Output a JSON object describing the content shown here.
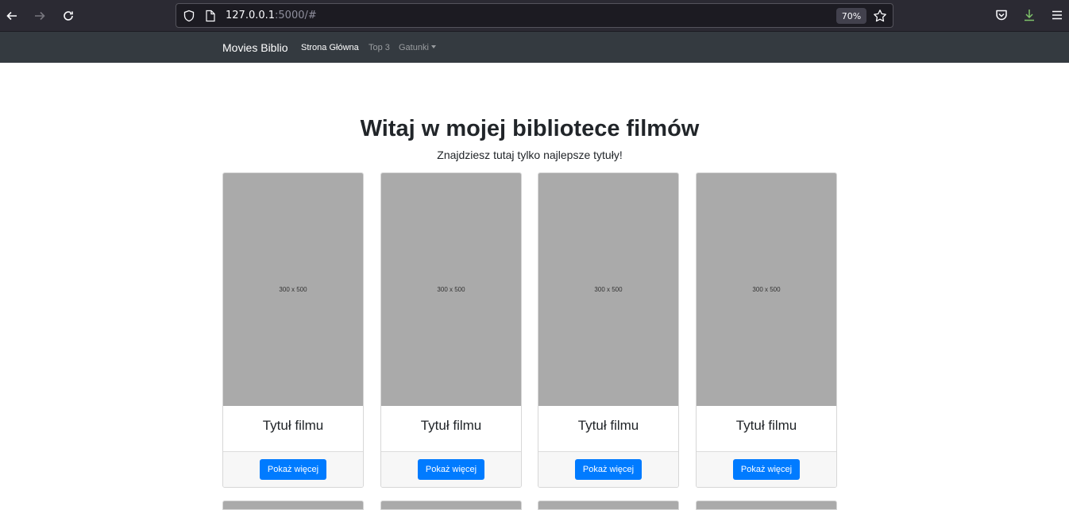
{
  "browser": {
    "url_host": "127.0.0.1",
    "url_rest": ":5000/#",
    "zoom": "70%"
  },
  "navbar": {
    "brand": "Movies Biblio",
    "links": [
      {
        "label": "Strona Główna",
        "active": true
      },
      {
        "label": "Top 3",
        "active": false
      },
      {
        "label": "Gatunki",
        "active": false,
        "dropdown": true
      }
    ]
  },
  "hero": {
    "title": "Witaj w mojej bibliotece filmów",
    "subtitle": "Znajdziesz tutaj tylko najlepsze tytuły!"
  },
  "cards": [
    {
      "placeholder": "300 x 500",
      "title": "Tytuł filmu",
      "button": "Pokaż więcej"
    },
    {
      "placeholder": "300 x 500",
      "title": "Tytuł filmu",
      "button": "Pokaż więcej"
    },
    {
      "placeholder": "300 x 500",
      "title": "Tytuł filmu",
      "button": "Pokaż więcej"
    },
    {
      "placeholder": "300 x 500",
      "title": "Tytuł filmu",
      "button": "Pokaż więcej"
    }
  ],
  "colors": {
    "navbar_bg": "#343a40",
    "button_primary": "#007bff",
    "placeholder_bg": "#aaaaaa"
  }
}
